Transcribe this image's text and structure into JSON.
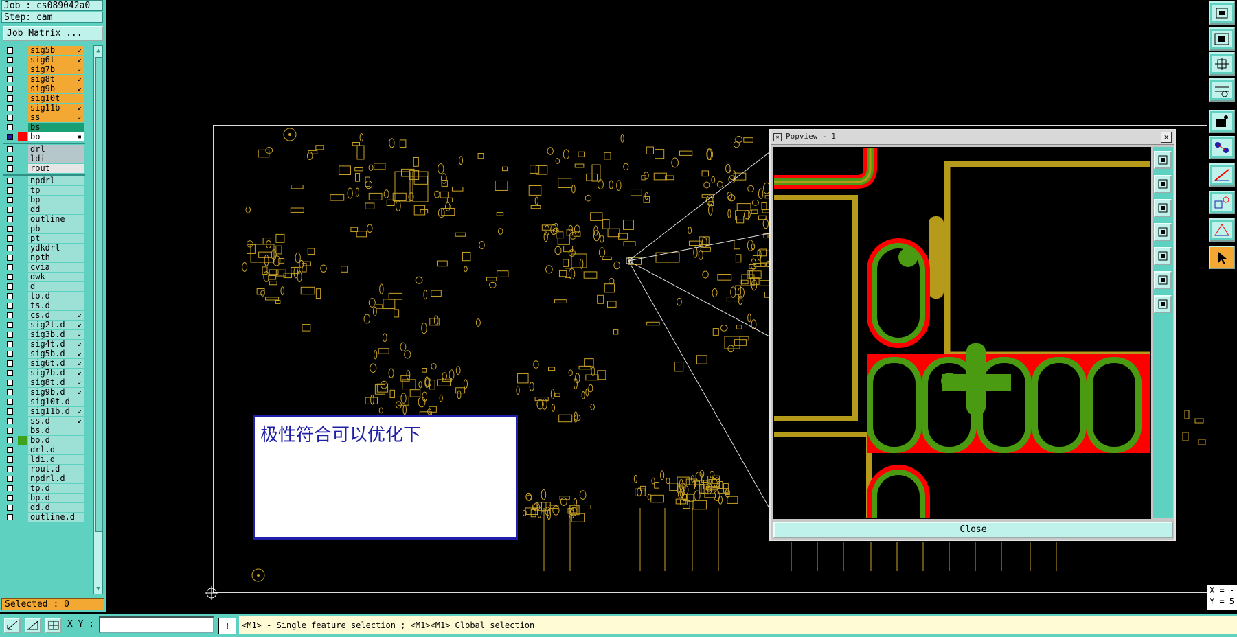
{
  "header": {
    "job_label": "Job : cs089042a0",
    "step_label": "Step: cam",
    "job_matrix_button": "Job Matrix ..."
  },
  "layers": [
    {
      "name": "sig5b",
      "color": "#f2a833",
      "mark": "↙"
    },
    {
      "name": "sig6t",
      "color": "#f2a833",
      "mark": "↙"
    },
    {
      "name": "sig7b",
      "color": "#f2a833",
      "mark": "↙"
    },
    {
      "name": "sig8t",
      "color": "#f2a833",
      "mark": "↙"
    },
    {
      "name": "sig9b",
      "color": "#f2a833",
      "mark": "↙"
    },
    {
      "name": "sig10t",
      "color": "#f2a833",
      "mark": ""
    },
    {
      "name": "sig11b",
      "color": "#f2a833",
      "mark": "↙"
    },
    {
      "name": "ss",
      "color": "#f2a833",
      "mark": "↙"
    },
    {
      "name": "bs",
      "color": "#1a9e73",
      "mark": ""
    },
    {
      "name": "bo",
      "color": "#ffffff",
      "mark": "▪",
      "active": true
    },
    {
      "name": "drl",
      "color": "#b6c7cc",
      "mark": ""
    },
    {
      "name": "ldi",
      "color": "#b6c7cc",
      "mark": ""
    },
    {
      "name": "rout",
      "color": "#e6e6e6",
      "mark": ""
    },
    {
      "name": "npdrl",
      "color": "#9de0d6",
      "mark": ""
    },
    {
      "name": "tp",
      "color": "#9de0d6",
      "mark": ""
    },
    {
      "name": "bp",
      "color": "#9de0d6",
      "mark": ""
    },
    {
      "name": "dd",
      "color": "#9de0d6",
      "mark": ""
    },
    {
      "name": "outline",
      "color": "#9de0d6",
      "mark": ""
    },
    {
      "name": "pb",
      "color": "#9de0d6",
      "mark": ""
    },
    {
      "name": "pt",
      "color": "#9de0d6",
      "mark": ""
    },
    {
      "name": "ydkdrl",
      "color": "#9de0d6",
      "mark": ""
    },
    {
      "name": "npth",
      "color": "#9de0d6",
      "mark": ""
    },
    {
      "name": "cvia",
      "color": "#9de0d6",
      "mark": ""
    },
    {
      "name": "dwk",
      "color": "#9de0d6",
      "mark": ""
    },
    {
      "name": "d",
      "color": "#9de0d6",
      "mark": ""
    },
    {
      "name": "to.d",
      "color": "#9de0d6",
      "mark": ""
    },
    {
      "name": "ts.d",
      "color": "#9de0d6",
      "mark": ""
    },
    {
      "name": "cs.d",
      "color": "#9de0d6",
      "mark": "↙"
    },
    {
      "name": "sig2t.d",
      "color": "#9de0d6",
      "mark": "↙"
    },
    {
      "name": "sig3b.d",
      "color": "#9de0d6",
      "mark": "↙"
    },
    {
      "name": "sig4t.d",
      "color": "#9de0d6",
      "mark": "↙"
    },
    {
      "name": "sig5b.d",
      "color": "#9de0d6",
      "mark": "↙"
    },
    {
      "name": "sig6t.d",
      "color": "#9de0d6",
      "mark": "↙"
    },
    {
      "name": "sig7b.d",
      "color": "#9de0d6",
      "mark": "↙"
    },
    {
      "name": "sig8t.d",
      "color": "#9de0d6",
      "mark": "↙"
    },
    {
      "name": "sig9b.d",
      "color": "#9de0d6",
      "mark": "↙"
    },
    {
      "name": "sig10t.d",
      "color": "#9de0d6",
      "mark": ""
    },
    {
      "name": "sig11b.d",
      "color": "#9de0d6",
      "mark": "↙"
    },
    {
      "name": "ss.d",
      "color": "#9de0d6",
      "mark": "↙"
    },
    {
      "name": "bs.d",
      "color": "#9de0d6",
      "mark": ""
    },
    {
      "name": "bo.d",
      "color": "#9de0d6",
      "mark": "",
      "swatch": "#3ea31a"
    },
    {
      "name": "drl.d",
      "color": "#9de0d6",
      "mark": ""
    },
    {
      "name": "ldi.d",
      "color": "#9de0d6",
      "mark": ""
    },
    {
      "name": "rout.d",
      "color": "#9de0d6",
      "mark": ""
    },
    {
      "name": "npdrl.d",
      "color": "#9de0d6",
      "mark": ""
    },
    {
      "name": "tp.d",
      "color": "#9de0d6",
      "mark": ""
    },
    {
      "name": "bp.d",
      "color": "#9de0d6",
      "mark": ""
    },
    {
      "name": "dd.d",
      "color": "#9de0d6",
      "mark": ""
    },
    {
      "name": "outline.d",
      "color": "#9de0d6",
      "mark": ""
    }
  ],
  "selected_label": "Selected : 0",
  "note": {
    "text": "极性符合可以优化下"
  },
  "popview": {
    "title": "Popview - 1",
    "close_button": "Close"
  },
  "xy_readout": {
    "x": "X = -",
    "y": "Y = 5"
  },
  "bottom": {
    "xy_label": "X Y :",
    "xy_value": "",
    "warning_glyph": "!",
    "status_message": "<M1> - Single feature selection ; <M1><M1> Global selection"
  },
  "colors": {
    "panel": "#5ed1c1",
    "panel_light": "#bff2ea",
    "component_outline": "#c9a227",
    "trace_olive": "#b59a1c",
    "pad_green": "#4a9a12",
    "pad_red": "#ff0000"
  }
}
